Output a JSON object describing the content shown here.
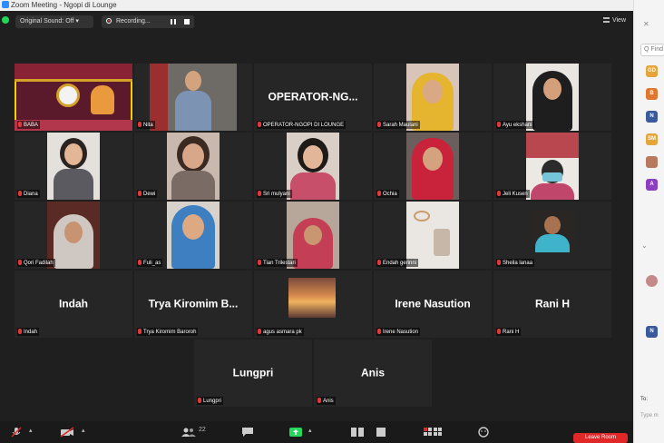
{
  "window": {
    "title": "Zoom Meeting - Ngopi di Lounge"
  },
  "topbar": {
    "subtitle_pill": "Original Sound: Off",
    "recording_label": "Recording...",
    "view_label": "View"
  },
  "participants": [
    {
      "name": "BABA"
    },
    {
      "name": "Nita"
    },
    {
      "name": "OPERATOR-NGOPI DI LOUNGE",
      "display": "OPERATOR-NG..."
    },
    {
      "name": "Sarah Maulani"
    },
    {
      "name": "Ayu ekshani"
    },
    {
      "name": "Diana"
    },
    {
      "name": "Dewi"
    },
    {
      "name": "Sri mulyani"
    },
    {
      "name": "Ochia"
    },
    {
      "name": "Jeli Kusen"
    },
    {
      "name": "Qori Fadilah"
    },
    {
      "name": "Fuli_as"
    },
    {
      "name": "Tian Trilestari"
    },
    {
      "name": "Endah gerinni"
    },
    {
      "name": "Sheila lanaa"
    },
    {
      "name": "Indah",
      "display": "Indah"
    },
    {
      "name": "Trya Kiromim Baroroh",
      "display": "Trya Kiromim B..."
    },
    {
      "name": "agus asmara pk"
    },
    {
      "name": "Irene Nasution",
      "display": "Irene Nasution"
    },
    {
      "name": "Rani H",
      "display": "Rani H"
    },
    {
      "name": "Lungpri",
      "display": "Lungpri"
    },
    {
      "name": "Anis",
      "display": "Anis"
    }
  ],
  "sidebar": {
    "search_placeholder": "Q Find",
    "avatars": [
      "GD",
      "B",
      "N",
      "SM",
      "A"
    ],
    "to_label": "To:",
    "type_placeholder": "Type m"
  },
  "toolbar": {
    "participants_count": "22",
    "leave_label": "Leave Room"
  },
  "colors": {
    "active_speaker": "#f5d000",
    "muted_mic": "#e23a3a",
    "leave": "#e02828",
    "accent": "#2d8cff"
  }
}
